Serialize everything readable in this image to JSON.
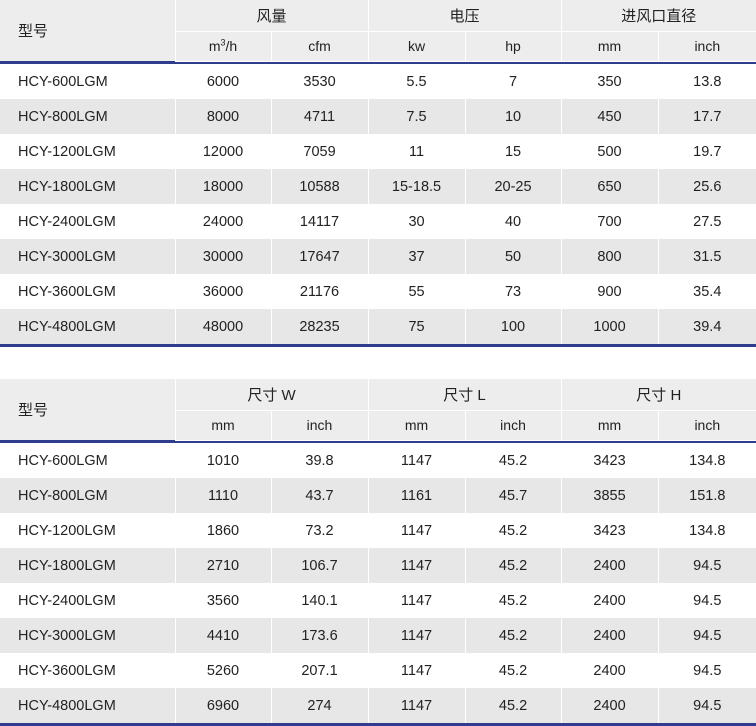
{
  "tables": [
    {
      "name": "performance-table",
      "model_header": "型号",
      "groups": [
        {
          "label": "风量",
          "units": [
            "m3/h",
            "cfm"
          ]
        },
        {
          "label": "电压",
          "units": [
            "kw",
            "hp"
          ]
        },
        {
          "label": "进风口直径",
          "units": [
            "mm",
            "inch"
          ]
        }
      ],
      "rows": [
        {
          "model": "HCY-600LGM",
          "values": [
            "6000",
            "3530",
            "5.5",
            "7",
            "350",
            "13.8"
          ]
        },
        {
          "model": "HCY-800LGM",
          "values": [
            "8000",
            "4711",
            "7.5",
            "10",
            "450",
            "17.7"
          ]
        },
        {
          "model": "HCY-1200LGM",
          "values": [
            "12000",
            "7059",
            "11",
            "15",
            "500",
            "19.7"
          ]
        },
        {
          "model": "HCY-1800LGM",
          "values": [
            "18000",
            "10588",
            "15-18.5",
            "20-25",
            "650",
            "25.6"
          ]
        },
        {
          "model": "HCY-2400LGM",
          "values": [
            "24000",
            "14117",
            "30",
            "40",
            "700",
            "27.5"
          ]
        },
        {
          "model": "HCY-3000LGM",
          "values": [
            "30000",
            "17647",
            "37",
            "50",
            "800",
            "31.5"
          ]
        },
        {
          "model": "HCY-3600LGM",
          "values": [
            "36000",
            "21176",
            "55",
            "73",
            "900",
            "35.4"
          ]
        },
        {
          "model": "HCY-4800LGM",
          "values": [
            "48000",
            "28235",
            "75",
            "100",
            "1000",
            "39.4"
          ]
        }
      ]
    },
    {
      "name": "dimensions-table",
      "model_header": "型号",
      "groups": [
        {
          "label": "尺寸 W",
          "units": [
            "mm",
            "inch"
          ]
        },
        {
          "label": "尺寸 L",
          "units": [
            "mm",
            "inch"
          ]
        },
        {
          "label": "尺寸 H",
          "units": [
            "mm",
            "inch"
          ]
        }
      ],
      "rows": [
        {
          "model": "HCY-600LGM",
          "values": [
            "1010",
            "39.8",
            "1147",
            "45.2",
            "3423",
            "134.8"
          ]
        },
        {
          "model": "HCY-800LGM",
          "values": [
            "1110",
            "43.7",
            "1161",
            "45.7",
            "3855",
            "151.8"
          ]
        },
        {
          "model": "HCY-1200LGM",
          "values": [
            "1860",
            "73.2",
            "1147",
            "45.2",
            "3423",
            "134.8"
          ]
        },
        {
          "model": "HCY-1800LGM",
          "values": [
            "2710",
            "106.7",
            "1147",
            "45.2",
            "2400",
            "94.5"
          ]
        },
        {
          "model": "HCY-2400LGM",
          "values": [
            "3560",
            "140.1",
            "1147",
            "45.2",
            "2400",
            "94.5"
          ]
        },
        {
          "model": "HCY-3000LGM",
          "values": [
            "4410",
            "173.6",
            "1147",
            "45.2",
            "2400",
            "94.5"
          ]
        },
        {
          "model": "HCY-3600LGM",
          "values": [
            "5260",
            "207.1",
            "1147",
            "45.2",
            "2400",
            "94.5"
          ]
        },
        {
          "model": "HCY-4800LGM",
          "values": [
            "6960",
            "274",
            "1147",
            "45.2",
            "2400",
            "94.5"
          ]
        }
      ]
    }
  ],
  "colors": {
    "rule": "#2f3d8c",
    "header_bg": "#ededed",
    "row_even_bg": "#e7e7e7",
    "row_odd_bg": "#ffffff"
  }
}
